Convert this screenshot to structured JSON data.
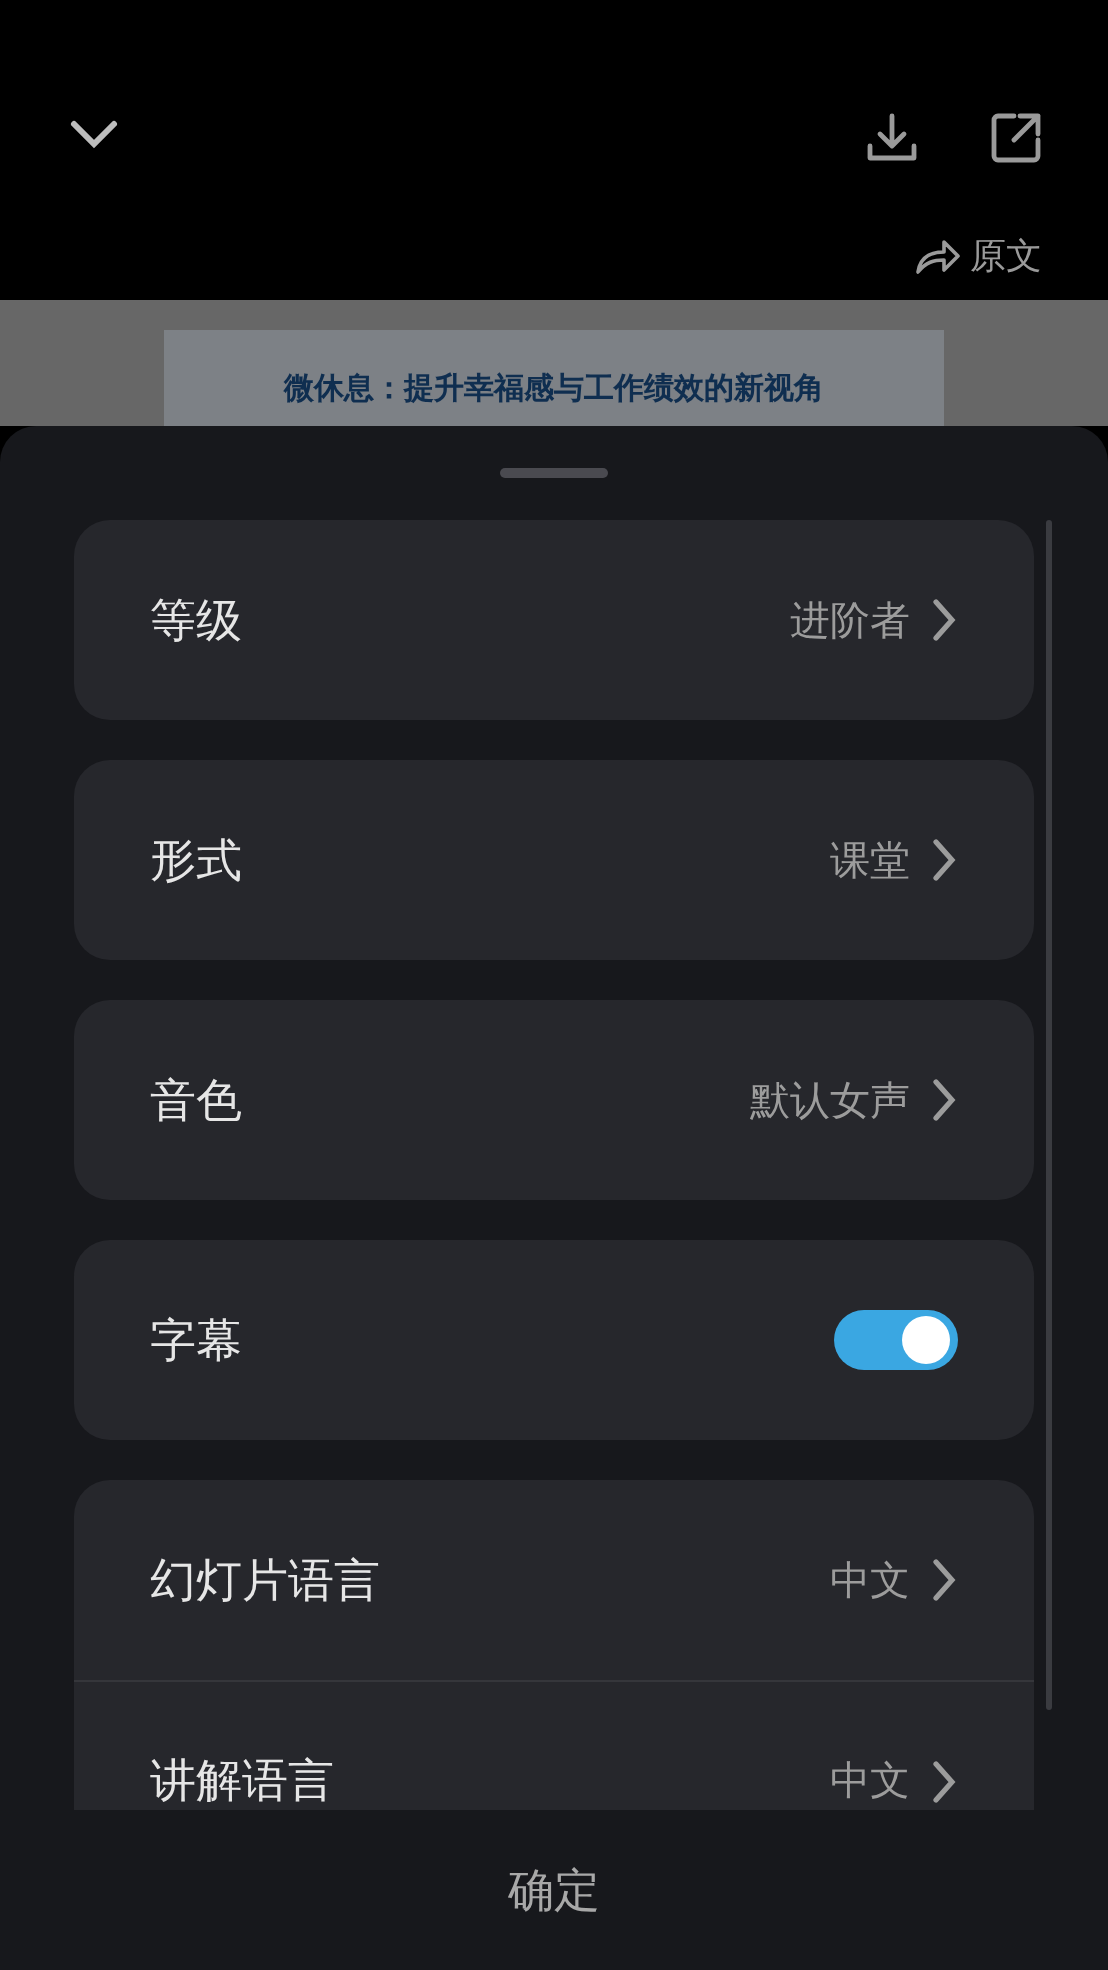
{
  "top_bar": {
    "source_link": "原文"
  },
  "document": {
    "title": "微休息：提升幸福感与工作绩效的新视角"
  },
  "settings_sheet": {
    "groups": [
      {
        "rows": [
          {
            "kind": "select",
            "label": "等级",
            "value": "进阶者"
          }
        ]
      },
      {
        "rows": [
          {
            "kind": "select",
            "label": "形式",
            "value": "课堂"
          }
        ]
      },
      {
        "rows": [
          {
            "kind": "select",
            "label": "音色",
            "value": "默认女声"
          }
        ]
      },
      {
        "rows": [
          {
            "kind": "toggle",
            "label": "字幕",
            "on": true
          }
        ]
      },
      {
        "rows": [
          {
            "kind": "select",
            "label": "幻灯片语言",
            "value": "中文"
          },
          {
            "kind": "select",
            "label": "讲解语言",
            "value": "中文"
          }
        ]
      }
    ],
    "confirm_button": "确定"
  }
}
